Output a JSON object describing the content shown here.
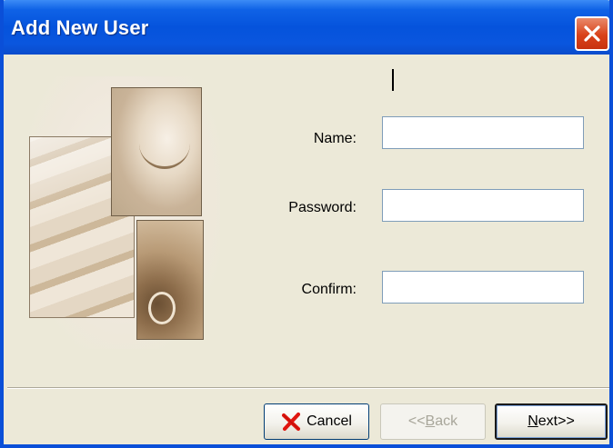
{
  "window": {
    "title": "Add New User",
    "close_icon": "close-x-icon"
  },
  "form": {
    "name_label": "Name:",
    "name_value": "",
    "password_label": "Password:",
    "password_value": "",
    "confirm_label": "Confirm:",
    "confirm_value": ""
  },
  "buttons": {
    "cancel_label": "Cancel",
    "cancel_icon": "red-x-icon",
    "back_prefix": "<<",
    "back_accel": "B",
    "back_rest": "ack",
    "back_enabled": false,
    "next_accel": "N",
    "next_rest": "ext>>",
    "next_default": true
  },
  "colors": {
    "titlebar": "#0553dc",
    "window_face": "#ece9d8",
    "close_button": "#d9421a",
    "cancel_x": "#e0160f"
  }
}
